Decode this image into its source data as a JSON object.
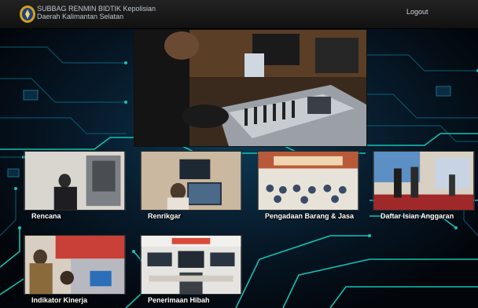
{
  "header": {
    "brand_line1": "SUBBAG RENMIN BIDTIK Kepolisian",
    "brand_line2": "Daerah Kalimantan Selatan",
    "logout_label": "Logout",
    "logo_icon": "police-crest-icon"
  },
  "colors": {
    "background": "#03080f",
    "circuit": "#15d6c4",
    "circuit_dim": "#0a5f78",
    "topbar": "#1a1a1a",
    "label_text": "#ffffff"
  },
  "hero": {
    "alt": "operator at audio mixing console"
  },
  "menu": {
    "items": [
      {
        "label": "Rencana"
      },
      {
        "label": "Renrikgar"
      },
      {
        "label": "Pengadaan Barang & Jasa"
      },
      {
        "label": "Daftar Isian Anggaran"
      },
      {
        "label": "Indikator Kinerja"
      },
      {
        "label": "Penerimaan Hibah"
      }
    ]
  }
}
